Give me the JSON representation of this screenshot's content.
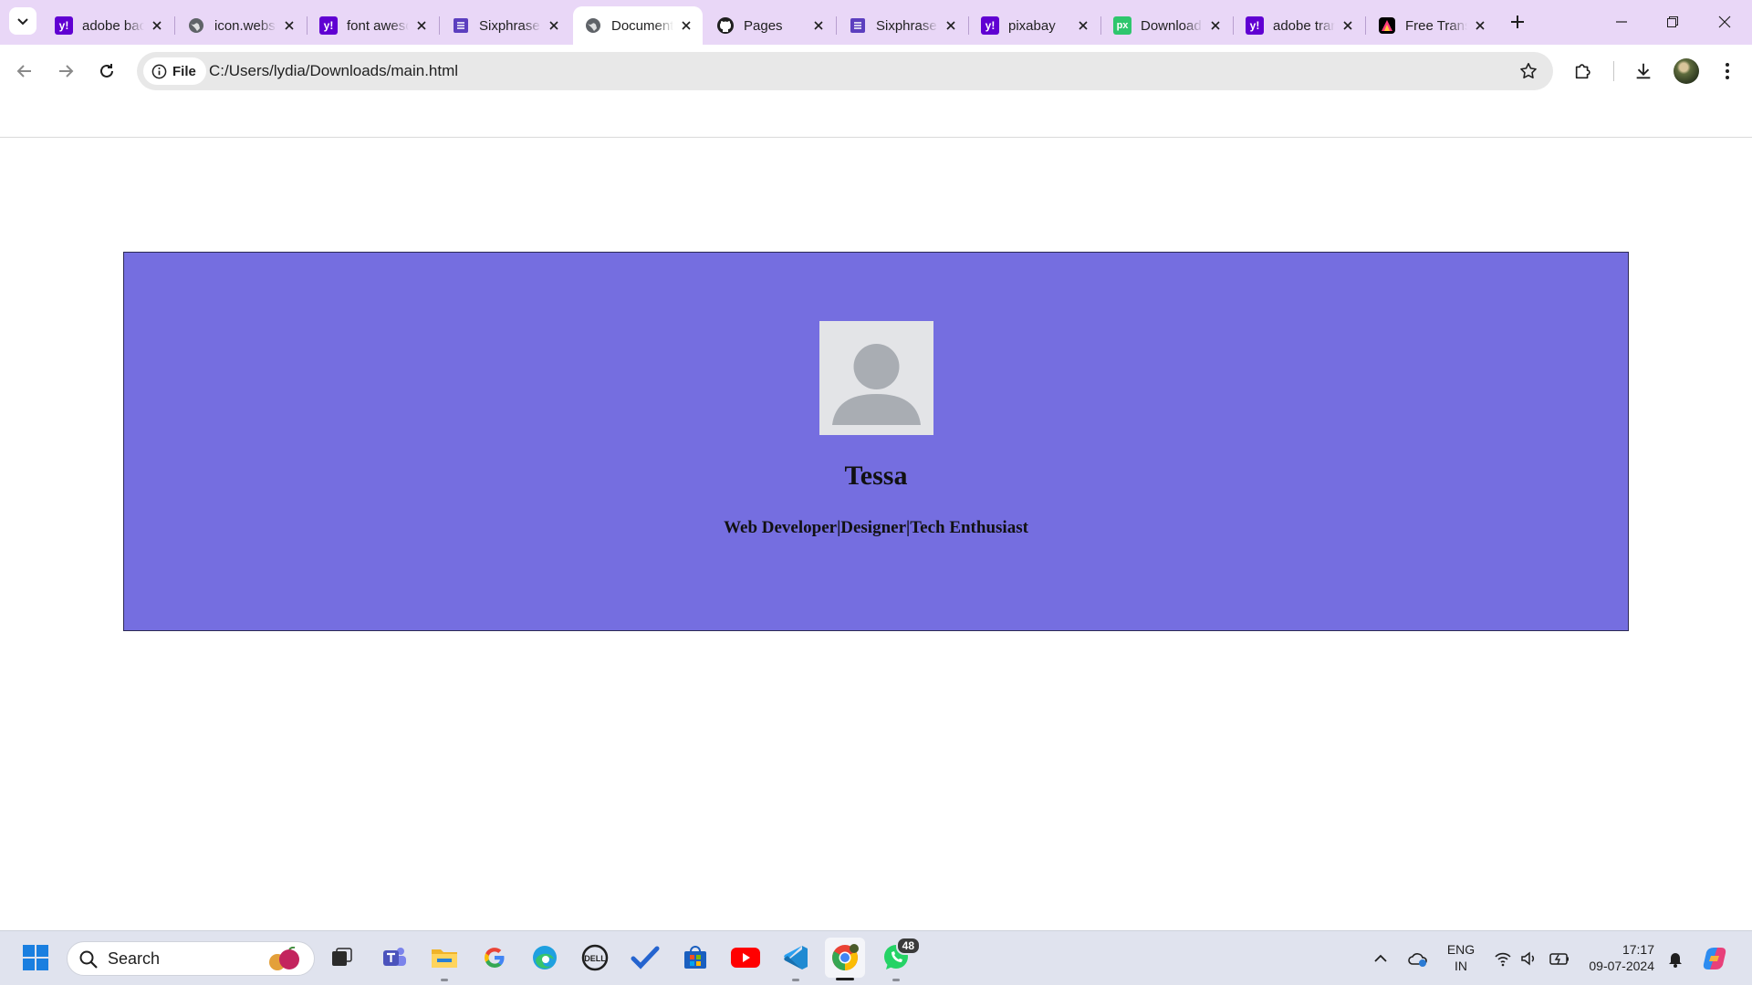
{
  "browser": {
    "tabs": [
      {
        "title": "adobe background remover",
        "favicon": "yahoo-icon",
        "color": "#6001d2"
      },
      {
        "title": "icon.website",
        "favicon": "globe-icon",
        "color": "#5f6368"
      },
      {
        "title": "font awesome",
        "favicon": "yahoo-icon",
        "color": "#6001d2"
      },
      {
        "title": "Sixphrase",
        "favicon": "sixphrase-icon",
        "color": "#5c3fbf"
      },
      {
        "title": "Document",
        "favicon": "globe-icon",
        "color": "#5f6368",
        "active": true
      },
      {
        "title": "Pages",
        "favicon": "github-icon",
        "color": "#1f1f1f"
      },
      {
        "title": "Sixphrase",
        "favicon": "sixphrase-icon",
        "color": "#5c3fbf"
      },
      {
        "title": "pixabay",
        "favicon": "yahoo-icon",
        "color": "#6001d2"
      },
      {
        "title": "Download",
        "favicon": "pixabay-px-icon",
        "color": "#2ec66d"
      },
      {
        "title": "adobe translate",
        "favicon": "yahoo-icon",
        "color": "#6001d2"
      },
      {
        "title": "Free Translate",
        "favicon": "adobe-express-icon",
        "color": "#000000"
      }
    ],
    "site_chip_label": "File",
    "url": "C:/Users/lydia/Downloads/main.html"
  },
  "profile": {
    "name": "Tessa",
    "tagline": "Web Developer|Designer|Tech Enthusiast",
    "card_color": "#756ee0"
  },
  "taskbar": {
    "search_label": "Search",
    "whatsapp_badge": "48",
    "language_line1": "ENG",
    "language_line2": "IN",
    "time": "17:17",
    "date": "09-07-2024"
  }
}
